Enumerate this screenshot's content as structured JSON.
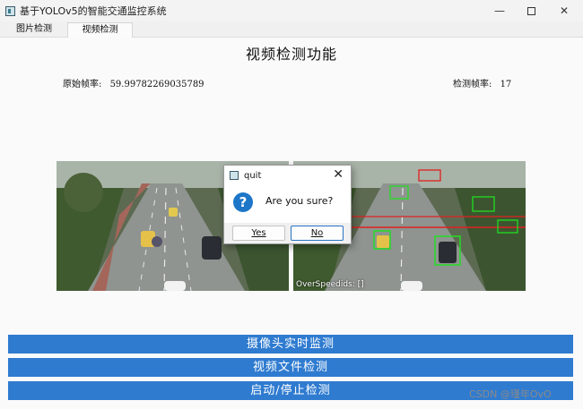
{
  "window": {
    "title": "基于YOLOv5的智能交通监控系统",
    "controls": {
      "minimize": "—",
      "close": "✕"
    }
  },
  "tabs": [
    {
      "label": "图片检测",
      "active": false
    },
    {
      "label": "视频检测",
      "active": true
    }
  ],
  "page": {
    "title": "视频检测功能",
    "original_fps_label": "原始帧率:",
    "original_fps_value": "59.99782269035789",
    "detect_fps_label": "检测帧率:",
    "detect_fps_value": "17"
  },
  "right_video": {
    "overspeed_text": "OverSpeedids: []"
  },
  "dialog": {
    "title": "quit",
    "close": "✕",
    "icon": "question-icon",
    "icon_glyph": "?",
    "message": "Are you sure?",
    "yes_label": "Yes",
    "no_label": "No"
  },
  "actions": [
    {
      "label": "摄像头实时监测"
    },
    {
      "label": "视频文件检测"
    },
    {
      "label": "启动/停止检测"
    }
  ],
  "watermark": "CSDN @瑾年OvO",
  "colors": {
    "accent": "#2f7bd0",
    "dialog_icon": "#1e76c8",
    "detection_box": "#22dd22",
    "speed_line": "#e02020"
  }
}
